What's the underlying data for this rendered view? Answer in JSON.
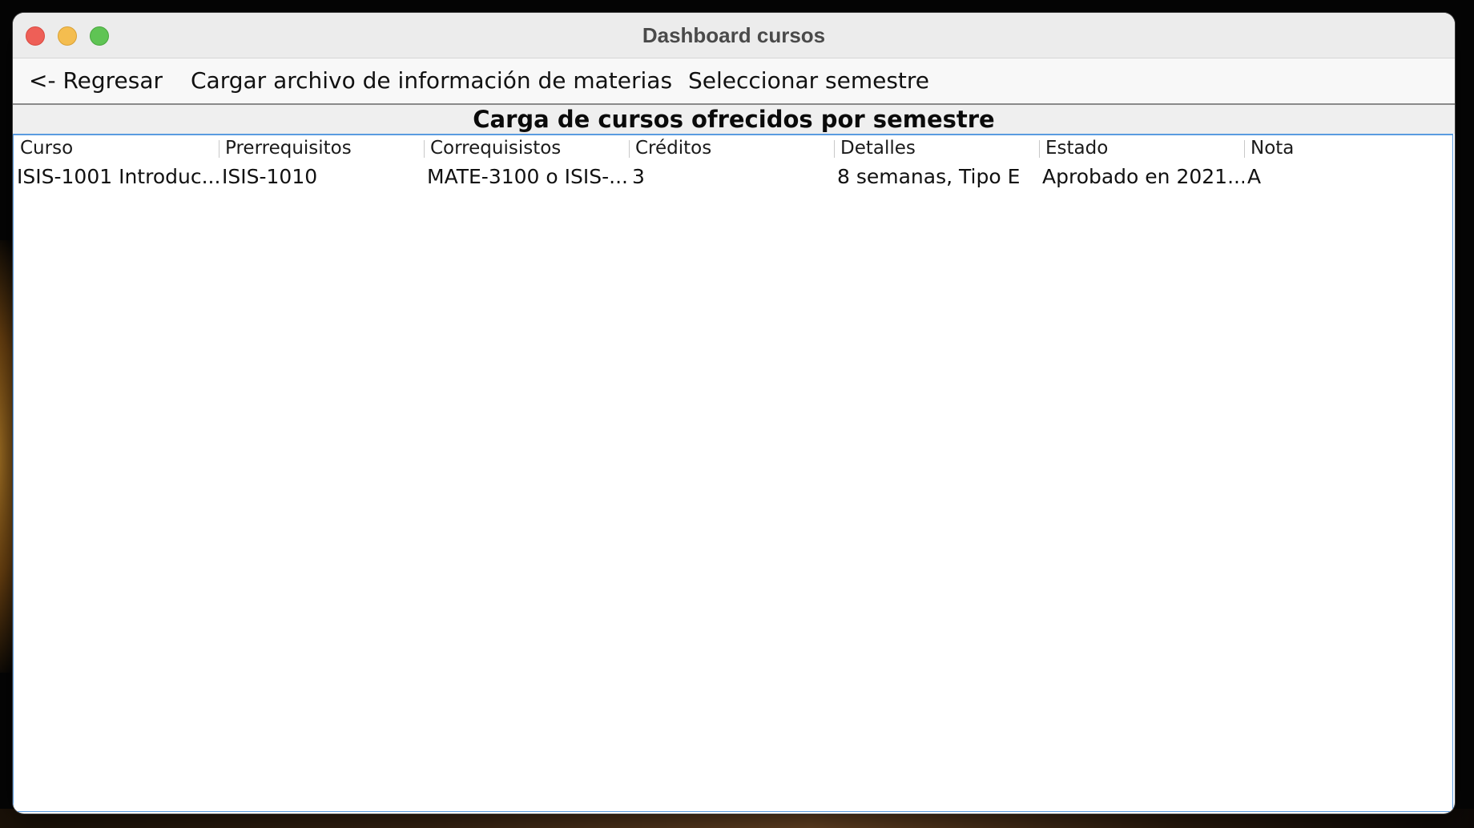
{
  "window": {
    "title": "Dashboard cursos"
  },
  "menu": {
    "back": "<- Regresar",
    "load_file": "Cargar archivo de información de materias",
    "select_semester": "Seleccionar semestre"
  },
  "heading": "Carga de cursos ofrecidos por semestre",
  "table": {
    "columns": [
      "Curso",
      "Prerrequisitos",
      "Correquisistos",
      "Créditos",
      "Detalles",
      "Estado",
      "Nota"
    ],
    "rows": [
      [
        "ISIS-1001 Introduc...",
        "ISIS-1010",
        "MATE-3100 o ISIS-...",
        "3",
        "8 semanas, Tipo E",
        "Aprobado en 2021...",
        "A"
      ]
    ]
  },
  "colors": {
    "close": "#ee5f57",
    "minimize": "#f4bd4f",
    "maximize": "#5fc454",
    "selection_border": "#5a9be0"
  }
}
